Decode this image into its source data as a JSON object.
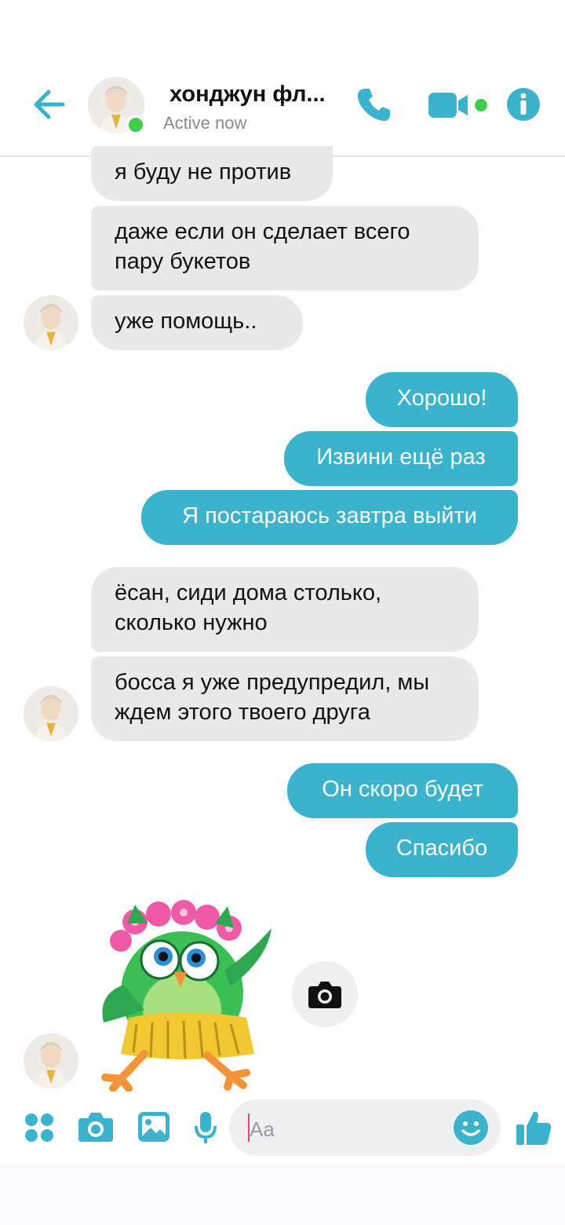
{
  "header": {
    "name": "хонджун фл...",
    "status": "Active now",
    "icons": [
      "back-arrow-icon",
      "phone-icon",
      "video-camera-icon",
      "info-icon"
    ],
    "accent_color": "#3bb3cc",
    "online_color": "#3fce4c"
  },
  "messages": [
    {
      "side": "in",
      "text": "я буду не против"
    },
    {
      "side": "in",
      "text": "даже если он сделает всего пару букетов"
    },
    {
      "side": "in",
      "text": "уже помощь.."
    },
    {
      "side": "out",
      "text": "Хорошо!"
    },
    {
      "side": "out",
      "text": "Извини ещё раз"
    },
    {
      "side": "out",
      "text": "Я постараюсь завтра выйти"
    },
    {
      "side": "in",
      "text": "ёсан, сиди дома столько, сколько нужно"
    },
    {
      "side": "in",
      "text": "босса я уже предупредил, мы ждем этого твоего друга"
    },
    {
      "side": "out",
      "text": "Он скоро будет"
    },
    {
      "side": "out",
      "text": "Спасибо"
    }
  ],
  "sticker": {
    "icon": "owl-sticker-icon",
    "action_icon": "camera-icon"
  },
  "composer": {
    "placeholder": "Aa",
    "icons": [
      "apps-icon",
      "camera-icon",
      "gallery-icon",
      "microphone-icon",
      "emoji-icon",
      "thumbs-up-icon"
    ]
  },
  "colors": {
    "incoming_bubble": "#e9e9ec",
    "outgoing_bubble": "#3bb3cc"
  }
}
